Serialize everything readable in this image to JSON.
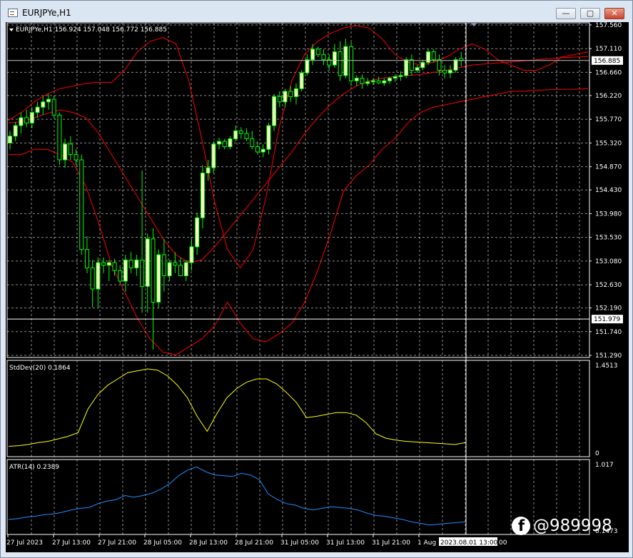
{
  "window": {
    "title": "EURJPYe,H1",
    "buttons": {
      "minimize": "—",
      "restore": "▢",
      "close": "✕"
    }
  },
  "main_panel": {
    "header": "EURJPYe,H1  156.924 157.048 156.772 156.885",
    "current_price": "156.885",
    "crosshair_price": "151.979"
  },
  "stddev_panel": {
    "label": "StdDev(20) 0.1864",
    "max_label": "1.4513",
    "min_label": "0"
  },
  "atr_panel": {
    "label": "ATR(14) 0.2389",
    "max_label": "1.017",
    "min_label": "0.1473"
  },
  "time_axis": {
    "labels": [
      "27 Jul 2023",
      "27 Jul 13:00",
      "27 Jul 21:00",
      "28 Jul 05:00",
      "28 Jul 13:00",
      "28 Jul 21:00",
      "31 Jul 05:00",
      "31 Jul 13:00",
      "31 Jul 21:00",
      "1 Aug"
    ],
    "crosshair_time": "2023.08.01 13:00",
    "trailing_digits": "00"
  },
  "watermark": {
    "icon": "facebook-icon",
    "text": "@989998"
  },
  "colors": {
    "bull_candle": "#ffffc8",
    "bull_outline": "#00ff00",
    "bands": "#ff0000",
    "stddev_line": "#ffff00",
    "atr_line": "#1e90ff",
    "grid": "#ffffff"
  },
  "chart_data": [
    {
      "type": "candlestick",
      "title": "EURJPYe,H1",
      "y_ticks": [
        157.56,
        157.11,
        156.66,
        156.22,
        155.77,
        155.32,
        154.87,
        154.43,
        153.98,
        153.53,
        153.08,
        152.63,
        152.19,
        151.74,
        151.29
      ],
      "ylim": [
        151.25,
        157.6
      ],
      "x_labels": [
        "27 Jul 2023",
        "27 Jul 13:00",
        "27 Jul 21:00",
        "28 Jul 05:00",
        "28 Jul 13:00",
        "28 Jul 21:00",
        "31 Jul 05:00",
        "31 Jul 13:00",
        "31 Jul 21:00",
        "1 Aug"
      ],
      "ohlc": [
        [
          155.32,
          155.55,
          155.2,
          155.45
        ],
        [
          155.45,
          155.72,
          155.35,
          155.65
        ],
        [
          155.65,
          155.9,
          155.5,
          155.8
        ],
        [
          155.8,
          155.95,
          155.62,
          155.7
        ],
        [
          155.7,
          156.0,
          155.6,
          155.9
        ],
        [
          155.9,
          156.1,
          155.8,
          156.0
        ],
        [
          156.0,
          156.2,
          155.85,
          156.1
        ],
        [
          156.1,
          156.25,
          155.95,
          156.15
        ],
        [
          156.15,
          156.22,
          155.8,
          155.85
        ],
        [
          155.85,
          155.9,
          154.9,
          155.0
        ],
        [
          155.0,
          155.4,
          154.85,
          155.3
        ],
        [
          155.3,
          155.45,
          155.0,
          155.1
        ],
        [
          155.1,
          155.2,
          154.9,
          155.0
        ],
        [
          155.0,
          155.1,
          153.2,
          153.3
        ],
        [
          153.3,
          153.55,
          152.85,
          152.95
        ],
        [
          152.95,
          153.1,
          152.2,
          152.55
        ],
        [
          152.55,
          153.15,
          152.2,
          153.05
        ],
        [
          153.05,
          153.15,
          152.85,
          153.0
        ],
        [
          153.0,
          153.1,
          152.7,
          153.05
        ],
        [
          153.05,
          153.12,
          152.8,
          152.9
        ],
        [
          152.9,
          153.0,
          152.65,
          152.7
        ],
        [
          152.7,
          153.2,
          152.5,
          153.1
        ],
        [
          153.1,
          153.25,
          152.85,
          152.95
        ],
        [
          152.95,
          153.2,
          152.8,
          153.1
        ],
        [
          153.1,
          154.8,
          152.1,
          152.6
        ],
        [
          152.6,
          153.6,
          152.1,
          153.5
        ],
        [
          153.5,
          153.7,
          151.4,
          152.3
        ],
        [
          152.3,
          153.3,
          152.2,
          153.2
        ],
        [
          153.2,
          153.5,
          152.5,
          152.8
        ],
        [
          152.8,
          153.1,
          152.7,
          153.05
        ],
        [
          153.05,
          153.25,
          152.85,
          153.0
        ],
        [
          153.0,
          153.15,
          152.8,
          152.8
        ],
        [
          152.8,
          153.1,
          152.7,
          153.05
        ],
        [
          153.05,
          153.5,
          152.9,
          153.35
        ],
        [
          153.35,
          154.0,
          153.2,
          153.9
        ],
        [
          153.9,
          154.9,
          153.7,
          154.75
        ],
        [
          154.75,
          155.0,
          154.6,
          154.85
        ],
        [
          154.85,
          155.35,
          154.75,
          155.3
        ],
        [
          155.3,
          155.42,
          155.2,
          155.35
        ],
        [
          155.35,
          155.4,
          155.2,
          155.25
        ],
        [
          155.25,
          155.45,
          155.2,
          155.4
        ],
        [
          155.4,
          155.65,
          155.35,
          155.55
        ],
        [
          155.55,
          155.62,
          155.4,
          155.5
        ],
        [
          155.5,
          155.6,
          155.35,
          155.4
        ],
        [
          155.4,
          155.55,
          155.2,
          155.25
        ],
        [
          155.25,
          155.35,
          155.1,
          155.15
        ],
        [
          155.15,
          155.3,
          155.05,
          155.2
        ],
        [
          155.2,
          155.7,
          155.1,
          155.65
        ],
        [
          155.65,
          156.25,
          155.55,
          156.2
        ],
        [
          156.2,
          156.3,
          156.0,
          156.1
        ],
        [
          156.1,
          156.35,
          156.0,
          156.3
        ],
        [
          156.3,
          156.4,
          156.1,
          156.2
        ],
        [
          156.2,
          156.45,
          156.05,
          156.35
        ],
        [
          156.35,
          156.7,
          156.3,
          156.65
        ],
        [
          156.65,
          157.0,
          156.6,
          156.9
        ],
        [
          156.9,
          157.2,
          156.8,
          157.1
        ],
        [
          157.1,
          157.15,
          156.95,
          157.0
        ],
        [
          157.0,
          157.1,
          156.8,
          156.9
        ],
        [
          156.9,
          157.0,
          156.7,
          156.8
        ],
        [
          156.8,
          157.2,
          156.75,
          157.05
        ],
        [
          157.05,
          157.25,
          156.5,
          156.6
        ],
        [
          156.6,
          157.3,
          156.55,
          157.15
        ],
        [
          157.15,
          157.25,
          156.4,
          156.5
        ],
        [
          156.5,
          156.6,
          156.4,
          156.55
        ],
        [
          156.55,
          156.62,
          156.35,
          156.45
        ],
        [
          156.45,
          156.55,
          156.4,
          156.48
        ],
        [
          156.48,
          156.55,
          156.42,
          156.5
        ],
        [
          156.5,
          156.58,
          156.44,
          156.46
        ],
        [
          156.46,
          156.55,
          156.4,
          156.5
        ],
        [
          156.5,
          156.58,
          156.44,
          156.55
        ],
        [
          156.55,
          156.62,
          156.48,
          156.58
        ],
        [
          156.58,
          156.68,
          156.5,
          156.6
        ],
        [
          156.6,
          156.95,
          156.55,
          156.9
        ],
        [
          156.9,
          157.0,
          156.6,
          156.7
        ],
        [
          156.7,
          156.8,
          156.65,
          156.75
        ],
        [
          156.75,
          156.9,
          156.7,
          156.85
        ],
        [
          156.85,
          157.1,
          156.8,
          157.05
        ],
        [
          157.05,
          157.1,
          156.85,
          156.9
        ],
        [
          156.9,
          157.0,
          156.6,
          156.7
        ],
        [
          156.7,
          156.8,
          156.55,
          156.65
        ],
        [
          156.65,
          156.8,
          156.55,
          156.7
        ],
        [
          156.7,
          156.95,
          156.65,
          156.9
        ],
        [
          156.924,
          157.048,
          156.772,
          156.885
        ]
      ],
      "bollinger": {
        "upper": [
          155.75,
          155.9,
          156.1,
          156.25,
          156.35,
          156.4,
          156.45,
          156.47,
          156.47,
          156.7,
          157.05,
          157.25,
          157.32,
          157.2,
          156.5,
          155.4,
          154.2,
          153.3,
          152.95,
          153.3,
          154.3,
          155.6,
          156.5,
          157.0,
          157.25,
          157.4,
          157.5,
          157.55,
          157.5,
          157.3,
          157.0,
          156.85,
          156.8,
          156.85,
          156.95,
          157.1,
          157.2,
          157.1,
          156.9,
          156.8,
          156.7,
          156.7,
          156.8,
          156.95,
          157.0,
          157.05
        ],
        "middle": [
          155.7,
          155.72,
          155.8,
          155.88,
          155.95,
          155.9,
          155.8,
          155.5,
          155.1,
          154.7,
          154.3,
          153.9,
          153.5,
          153.2,
          153.05,
          153.1,
          153.35,
          153.65,
          153.95,
          154.25,
          154.55,
          154.85,
          155.15,
          155.5,
          155.8,
          156.05,
          156.25,
          156.4,
          156.5,
          156.55,
          156.58,
          156.6,
          156.62,
          156.66,
          156.7,
          156.75,
          156.8,
          156.82,
          156.84,
          156.86,
          156.88,
          156.9,
          156.92,
          156.94,
          156.95,
          156.96
        ],
        "lower": [
          155.1,
          155.1,
          155.2,
          155.2,
          155.1,
          154.95,
          154.5,
          153.8,
          153.0,
          152.5,
          152.0,
          151.6,
          151.35,
          151.3,
          151.45,
          151.6,
          151.85,
          152.3,
          151.9,
          151.6,
          151.55,
          151.7,
          151.9,
          152.3,
          152.9,
          153.6,
          154.4,
          154.7,
          154.9,
          155.2,
          155.4,
          155.7,
          155.9,
          156.0,
          156.05,
          156.1,
          156.15,
          156.2,
          156.25,
          156.3,
          156.3,
          156.32,
          156.33,
          156.34,
          156.34,
          156.35
        ]
      }
    },
    {
      "type": "line",
      "title": "StdDev(20) 0.1864",
      "ylim": [
        0,
        1.4513
      ],
      "values": [
        0.12,
        0.13,
        0.15,
        0.18,
        0.2,
        0.24,
        0.28,
        0.34,
        0.72,
        0.95,
        1.1,
        1.2,
        1.3,
        1.33,
        1.36,
        1.34,
        1.25,
        1.1,
        0.9,
        0.6,
        0.36,
        0.65,
        0.9,
        1.05,
        1.15,
        1.2,
        1.2,
        1.12,
        0.98,
        0.82,
        0.58,
        0.6,
        0.63,
        0.66,
        0.66,
        0.62,
        0.5,
        0.32,
        0.25,
        0.22,
        0.2,
        0.19,
        0.18,
        0.17,
        0.16,
        0.15,
        0.18
      ]
    },
    {
      "type": "line",
      "title": "ATR(14) 0.2389",
      "ylim": [
        0.1473,
        1.017
      ],
      "values": [
        0.3,
        0.31,
        0.33,
        0.34,
        0.36,
        0.37,
        0.39,
        0.42,
        0.44,
        0.45,
        0.5,
        0.53,
        0.55,
        0.6,
        0.58,
        0.6,
        0.63,
        0.68,
        0.75,
        0.85,
        0.92,
        0.96,
        0.9,
        0.86,
        0.85,
        0.84,
        0.88,
        0.86,
        0.8,
        0.62,
        0.55,
        0.5,
        0.48,
        0.44,
        0.42,
        0.44,
        0.46,
        0.45,
        0.44,
        0.42,
        0.38,
        0.35,
        0.34,
        0.32,
        0.3,
        0.27,
        0.25,
        0.23,
        0.24,
        0.25,
        0.26,
        0.27
      ]
    }
  ]
}
